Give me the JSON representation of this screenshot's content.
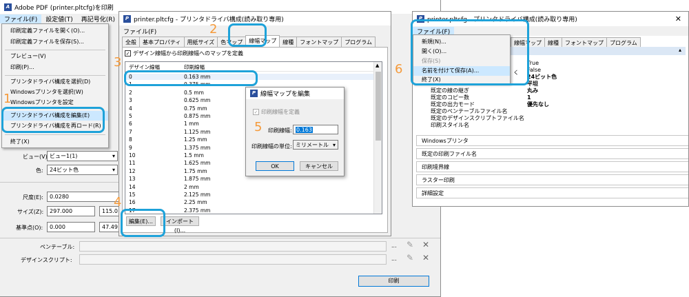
{
  "left_window": {
    "title": "Adobe PDF (printer.pltcfg)を印刷",
    "menubar": [
      "ファイル(F)",
      "設定値(T)",
      "再記号化(R)"
    ],
    "file_menu": [
      "印刷定義ファイルを開く(O)...",
      "印刷定義ファイルを保存(S)...",
      "プレビュー(V)",
      "印刷(P)...",
      "プリンタドライバ構成を選択(D)",
      "Windowsプリンタを選択(W)",
      "Windowsプリンタを設定",
      "プリンタドライバ構成を編集(E)",
      "プリンタドライバ構成を再ロード(R)",
      "終了(X)"
    ],
    "view_label": "ビュー(V):",
    "view_value": "ビュー1(1)",
    "color_label": "色:",
    "color_value": "24ビット色",
    "scale_label": "尺度(E):",
    "scale_value": "0.0280",
    "size_label": "サイズ(Z):",
    "size_w": "297.000",
    "size_h": "115.0",
    "base_label": "基準点(O):",
    "base_x": "0.000",
    "base_y": "47.49",
    "pentable_label": "ペンテーブル:",
    "designscript_label": "デザインスクリプト:",
    "print_button": "印刷",
    "ellipsis": "..."
  },
  "mid_window": {
    "title": "printer.pltcfg - プリンタドライバ構成(読み取り専用)",
    "menu_file": "ファイル(F)",
    "tabs": [
      "全般",
      "基本プロパティ",
      "用紙サイズ",
      "色マップ",
      "線幅マップ",
      "線種",
      "フォントマップ",
      "プログラム"
    ],
    "checkbox_label": "デザイン線幅から印刷線幅へのマップを定義",
    "col_design": "デザイン線幅",
    "col_print": "印刷線幅",
    "rows": [
      [
        "0",
        "0.163 mm"
      ],
      [
        "1",
        "0.375 mm"
      ],
      [
        "2",
        "0.5 mm"
      ],
      [
        "3",
        "0.625 mm"
      ],
      [
        "4",
        "0.75 mm"
      ],
      [
        "5",
        "0.875 mm"
      ],
      [
        "6",
        "1 mm"
      ],
      [
        "7",
        "1.125 mm"
      ],
      [
        "8",
        "1.25 mm"
      ],
      [
        "9",
        "1.375 mm"
      ],
      [
        "10",
        "1.5 mm"
      ],
      [
        "11",
        "1.625 mm"
      ],
      [
        "12",
        "1.75 mm"
      ],
      [
        "13",
        "1.875 mm"
      ],
      [
        "14",
        "2 mm"
      ],
      [
        "15",
        "2.125 mm"
      ],
      [
        "16",
        "2.25 mm"
      ],
      [
        "17",
        "2.375 mm"
      ]
    ],
    "edit_button": "編集(E)...",
    "import_button": "インポート(I)..."
  },
  "dialog": {
    "title": "線幅マップを編集",
    "checkbox_label": "印刷線幅を定義",
    "width_label": "印刷線幅:",
    "width_value": "0.163",
    "unit_label": "印刷線幅の単位:",
    "unit_value": "ミリメートル",
    "ok": "OK",
    "cancel": "キャンセル"
  },
  "right_window": {
    "title": "printer.pltcfg - プリンタドライバ構成(読み取り専用)",
    "menu_file": "ファイル(F)",
    "tabs": [
      "線幅マップ",
      "線種",
      "フォントマップ",
      "プログラム"
    ],
    "file_menu": [
      "新規(N)...",
      "開く(O)...",
      "保存(S)",
      "名前を付けて保存(A)...",
      "終了(X)"
    ],
    "props_left": [
      "既定の線の継ぎ",
      "既定のコピー数",
      "既定の出力モード",
      "既定のペンテーブルファイル名",
      "既定のデザインスクリプトファイル名",
      "印刷スタイル名"
    ],
    "props_right": [
      "True",
      "False",
      "24ビット色",
      "平坦",
      "丸み",
      "1",
      "優先なし"
    ],
    "partial_label": "く",
    "sections": [
      "Windowsプリンタ",
      "既定の印刷ファイル名",
      "印刷境界線",
      "ラスター印刷",
      "詳細設定"
    ]
  },
  "steps": [
    "1",
    "2",
    "3",
    "4",
    "5",
    "6"
  ],
  "accent_color": "#1ea2d9",
  "step_color": "#f59a3a"
}
